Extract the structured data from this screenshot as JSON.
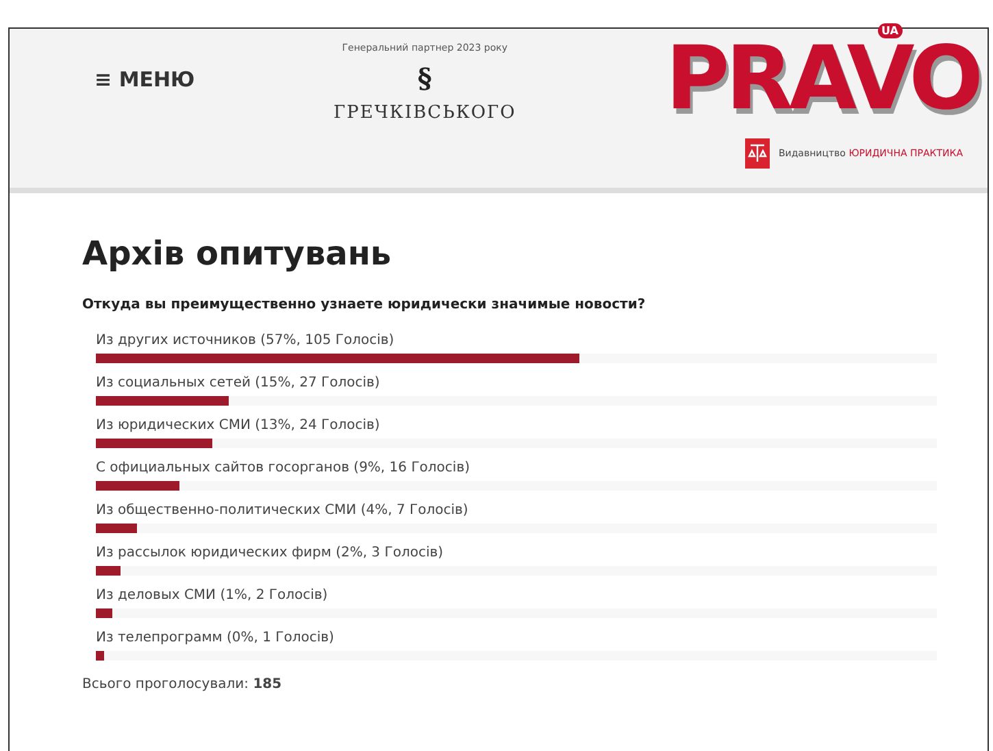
{
  "header": {
    "menu": {
      "icon": "≡",
      "label": "МЕНЮ"
    },
    "partner": {
      "caption": "Генеральний партнер 2023 року",
      "mark": "§",
      "name": "ГРЕЧКІВСЬКОГО"
    },
    "logo": {
      "text": "PRAVO",
      "badge": "UA"
    },
    "publisher": {
      "prefix": "Видавництво",
      "name": "ЮРИДИЧНА ПРАКТИКА"
    }
  },
  "title": "Архів опитувань",
  "poll": {
    "question": "Откуда вы преимущественно узнаете юридически значимые новости?",
    "answers": [
      {
        "label": "Из других источников (57%, 105 Голосів)",
        "level": 0.57
      },
      {
        "label": "Из социальных сетей (15%, 27 Голосів)",
        "level": 0.15
      },
      {
        "label": "Из юридических СМИ (13%, 24 Голосів)",
        "level": 0.13
      },
      {
        "label": "С официальных сайтов госорганов (9%, 16 Голосів)",
        "level": 0.09
      },
      {
        "label": "Из общественно-политических СМИ (4%, 7 Голосів)",
        "level": 0.04
      },
      {
        "label": "Из рассылок юридических фирм (2%, 3 Голосів)",
        "level": 0.02
      },
      {
        "label": "Из деловых СМИ (1%, 2 Голосів)",
        "level": 0.01
      },
      {
        "label": "Из телепрограмм (0%, 1 Голосів)",
        "level": 0
      }
    ],
    "total": {
      "label": "Всього проголосували:",
      "value": "185"
    }
  }
}
